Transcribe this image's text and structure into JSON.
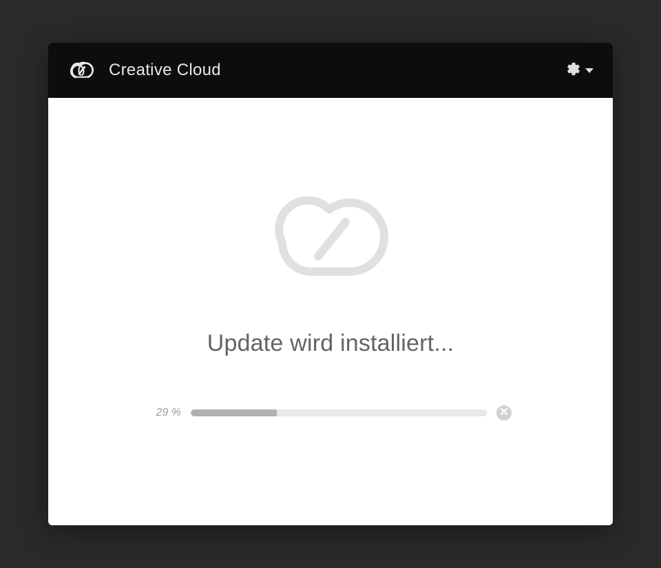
{
  "header": {
    "title": "Creative Cloud"
  },
  "main": {
    "status_text": "Update wird installiert...",
    "progress": {
      "label": "29 %",
      "percent": 29
    }
  },
  "colors": {
    "header_bg": "#0d0d0d",
    "body_bg": "#ffffff",
    "page_bg": "#2a2a2a",
    "progress_track": "#e8e8e8",
    "progress_fill": "#b0b0b0",
    "text_muted": "#636363"
  }
}
